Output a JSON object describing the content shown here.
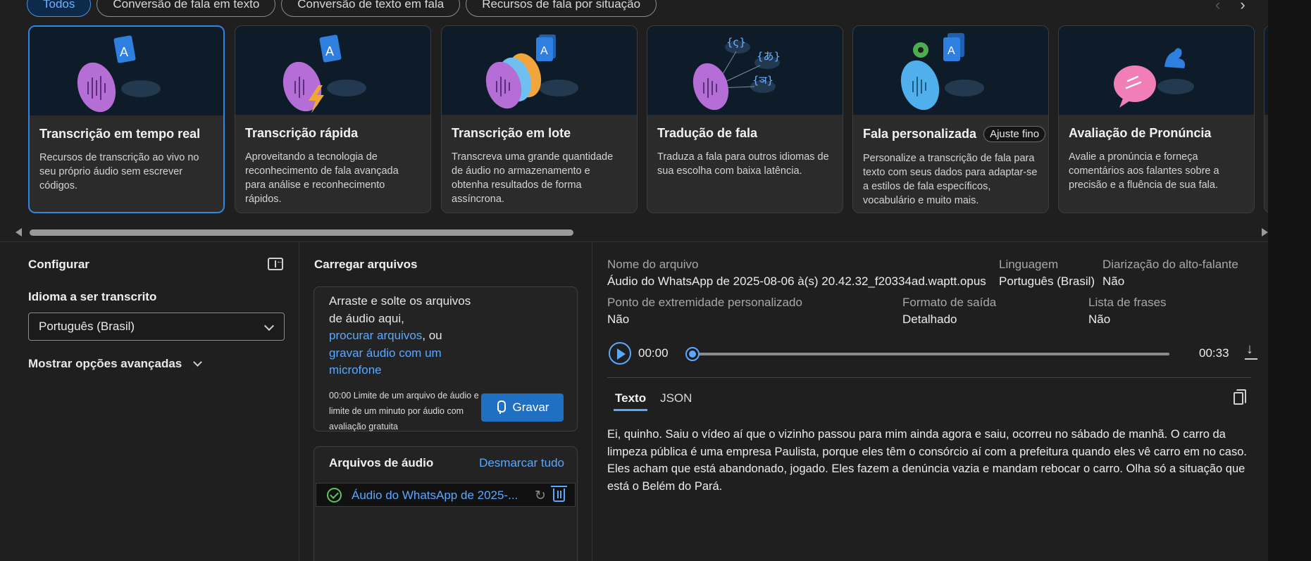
{
  "filters": [
    "Todos",
    "Conversão de fala em texto",
    "Conversão de texto em fala",
    "Recursos de fala por situação"
  ],
  "nav": {
    "prev": "‹",
    "next": "›"
  },
  "cards": [
    {
      "title": "Transcrição em tempo real",
      "badge": "",
      "desc": "Recursos de transcrição ao vivo no seu próprio áudio sem escrever códigos."
    },
    {
      "title": "Transcrição rápida",
      "badge": "",
      "desc": "Aproveitando a tecnologia de reconhecimento de fala avançada para análise e reconhecimento rápidos."
    },
    {
      "title": "Transcrição em lote",
      "badge": "",
      "desc": "Transcreva uma grande quantidade de áudio no armazenamento e obtenha resultados de forma assíncrona."
    },
    {
      "title": "Tradução de fala",
      "badge": "",
      "desc": "Traduza a fala para outros idiomas de sua escolha com baixa latência."
    },
    {
      "title": "Fala personalizada",
      "badge": "Ajuste fino",
      "desc": "Personalize a transcrição de fala para texto com seus dados para adaptar-se a estilos de fala específicos, vocabulário e muito mais."
    },
    {
      "title": "Avaliação de Pronúncia",
      "badge": "",
      "desc": "Avalie a pronúncia e forneça comentários aos falantes sobre a precisão e a fluência de sua fala."
    }
  ],
  "card_glyphs": {
    "letter_a": "A",
    "lang1": "{ς}",
    "lang2": "{あ}",
    "lang3": "{ञ}"
  },
  "configure": {
    "title": "Configurar",
    "language_label": "Idioma a ser transcrito",
    "language_value": "Português (Brasil)",
    "advanced": "Mostrar opções avançadas"
  },
  "upload": {
    "title": "Carregar arquivos",
    "drop_line1": "Arraste e solte os arquivos de áudio aqui,",
    "browse": "procurar arquivos",
    "or": ", ou",
    "record_link": "gravar áudio com um microfone",
    "limit": "00:00 Limite de um arquivo de áudio e limite de um minuto por áudio com avaliação gratuita",
    "record_button": "Gravar"
  },
  "audio_files": {
    "title": "Arquivos de áudio",
    "clear": "Desmarcar tudo",
    "items": [
      "Áudio do WhatsApp de 2025-..."
    ]
  },
  "details": {
    "file_name_label": "Nome do arquivo",
    "file_name": "Áudio do WhatsApp de 2025-08-06 à(s) 20.42.32_f20334ad.waptt.opus",
    "language_label": "Linguagem",
    "language": "Português (Brasil)",
    "diarization_label": "Diarização do alto-falante",
    "diarization": "Não",
    "endpoint_label": "Ponto de extremidade personalizado",
    "endpoint": "Não",
    "format_label": "Formato de saída",
    "format": "Detalhado",
    "phrases_label": "Lista de frases",
    "phrases": "Não"
  },
  "player": {
    "current": "00:00",
    "duration": "00:33",
    "progress": 0
  },
  "result_tabs": [
    "Texto",
    "JSON"
  ],
  "transcript": "Ei, quinho. Saiu o vídeo aí que o vizinho passou para mim ainda agora e saiu, ocorreu no sábado de manhã. O carro da limpeza pública é uma empresa Paulista, porque eles têm o consórcio aí com a prefeitura quando eles vê carro em no caso. Eles acham que está abandonado, jogado. Eles fazem a denúncia vazia e mandam rebocar o carro. Olha só a situação que está o Belém do Pará.",
  "colors": {
    "accent": "#2f86e0",
    "link": "#5aa8ff",
    "record_button": "#1f6fc2",
    "success": "#5fc35f"
  }
}
